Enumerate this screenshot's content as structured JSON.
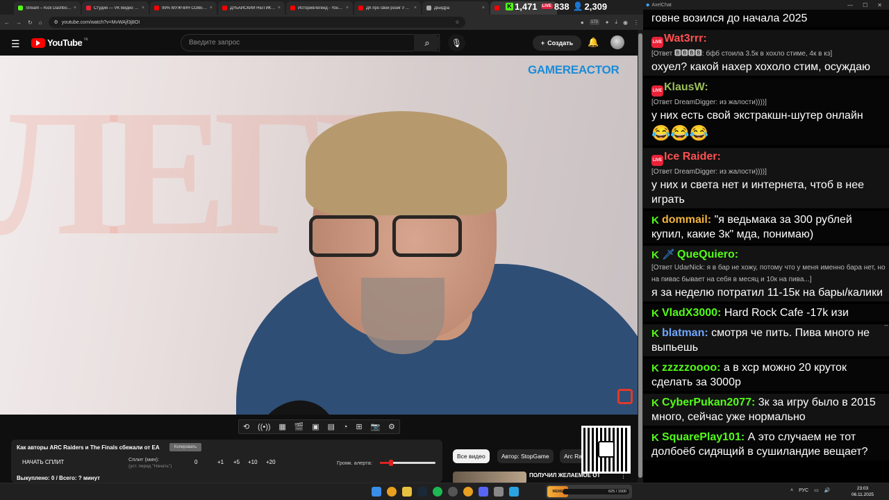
{
  "browser": {
    "tabs": [
      {
        "title": "Stream – Kick Dashboard",
        "fav": "#53fc18"
      },
      {
        "title": "Студия — VK Видео Live",
        "fav": "#e82238"
      },
      {
        "title": "99% МУЖЧИН СОВЕРШ...",
        "fav": "#ff0000"
      },
      {
        "title": "ДУБАЙСКИЙ НЫТИК - ...",
        "fav": "#ff0000"
      },
      {
        "title": "ИсторияЛегенд - YouTube",
        "fav": "#ff0000"
      },
      {
        "title": "ДК про свой розиг // ...",
        "fav": "#ff0000"
      },
      {
        "title": "ДБиДра",
        "fav": "#aaaaaa"
      },
      {
        "title": "",
        "fav": "#ff0000"
      }
    ],
    "url": "youtube.com/watch?v=MvWAjf3j8OI",
    "stats": {
      "kick": "1,471",
      "vk": "838",
      "viewers": "2,309"
    },
    "ext_badge": "173"
  },
  "youtube": {
    "logo_text": "YouTube",
    "region": "NL",
    "search_placeholder": "Введите запрос",
    "create_label": "Создать"
  },
  "video": {
    "watermark": "GAMEREACTOR"
  },
  "panel": {
    "title": "Как авторы ARC Raiders и The Finals сбежали от EA",
    "copy": "Копировать",
    "start_split": "НАЧАТЬ СПЛИТ",
    "split_label": "Сплит (мин):",
    "split_hint": "(уст. перед \"Начать\")",
    "split_value": "0",
    "increments": [
      "+1",
      "+5",
      "+10",
      "+20"
    ],
    "alert_label": "Громк. алерта:",
    "alert_volume": 0.2,
    "bought": "Выкуплено: 0 / Всего: ? минут"
  },
  "chips": [
    "Все видео",
    "Автор: StopGame",
    "Arc Ra"
  ],
  "recommended": {
    "title": "ПОЛУЧИЛ ЖЕЛАЕМОЕ ОТ"
  },
  "chat": {
    "window_title": "AxelChat",
    "messages": [
      {
        "platform": "none",
        "nick": "",
        "color": "#ffffff",
        "reply": "",
        "text": "говне возился до начала 2025",
        "emotes": ""
      },
      {
        "platform": "vk",
        "nick": "Wat3rrr:",
        "color": "#ff5050",
        "reply": "[Ответ 🅱🅱🅱🅱: бфб стоила 3.5к в хохло стиме, 4к в кз]",
        "text": "охуел? какой нахер хохоло стим, осуждаю",
        "emotes": ""
      },
      {
        "platform": "vk",
        "nick": "KlausW:",
        "color": "#9bbf5a",
        "reply": "[Ответ DreamDigger: из жалости))))]",
        "text": "у них есть свой экстракшн-шутер онлайн",
        "emotes": "😂😂😂"
      },
      {
        "platform": "vk",
        "nick": "Ice Raider:",
        "color": "#ff5050",
        "reply": "[Ответ DreamDigger: из жалости))))]",
        "text": "у них и света нет и интернета, чтоб в нее играть",
        "emotes": ""
      },
      {
        "platform": "kick",
        "nick": "dommail:",
        "color": "#f2b33d",
        "reply": "",
        "text": "\"я ведьмака за 300 рублей купил, какие 3к\" мда, понимаю)",
        "emotes": ""
      },
      {
        "platform": "kick-sword",
        "nick": "QueQuiero:",
        "color": "#53fc18",
        "reply": "[Ответ UdarNick: я в бар не хожу, потому что у меня именно бара нет, но на пивас бывает на себя в месяц и 10к на пива...]",
        "text": "я за неделю потратил 11-15к на бары/калики",
        "emotes": ""
      },
      {
        "platform": "kick",
        "nick": "VladX3000:",
        "color": "#53fc18",
        "reply": "",
        "text": "Hard Rock Cafe -17k изи",
        "emotes": ""
      },
      {
        "platform": "kick",
        "nick": "blatman:",
        "color": "#6fa8ff",
        "reply": "",
        "text": "смотря че пить. Пива много не выпьешь",
        "emotes": ""
      },
      {
        "platform": "kick",
        "nick": "zzzzzoooo:",
        "color": "#53fc18",
        "reply": "",
        "text": "а в хср можно 20 круток сделать за 3000р",
        "emotes": ""
      },
      {
        "platform": "kick",
        "nick": "CyberPukan2077:",
        "color": "#53fc18",
        "reply": "",
        "text": "3к за игру было в 2015 много, сейчас уже нормально",
        "emotes": ""
      },
      {
        "platform": "kick",
        "nick": "SquarePlay101:",
        "color": "#53fc18",
        "reply": "",
        "text": "А это случаем не тот долбоёб сидящий в сушиландие вещает?",
        "emotes": ""
      }
    ]
  },
  "taskbar": {
    "app_label": "MEME PARTY",
    "app_progress": "625 / 1500",
    "lang": "РУС",
    "time": "23:03",
    "date": "06.11.2025"
  }
}
